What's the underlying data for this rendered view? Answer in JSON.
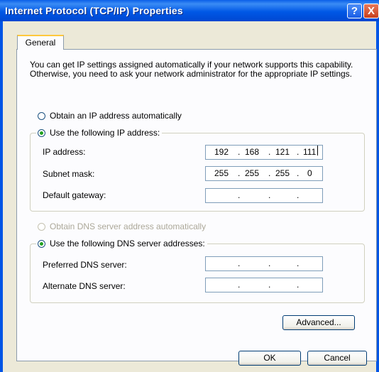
{
  "window": {
    "title": "Internet Protocol (TCP/IP) Properties",
    "help_label": "?",
    "close_label": "X"
  },
  "tabs": [
    {
      "label": "General",
      "active": true
    }
  ],
  "intro_text": "You can get IP settings assigned automatically if your network supports this capability. Otherwise, you need to ask your network administrator for the appropriate IP settings.",
  "ip_section": {
    "auto_label": "Obtain an IP address automatically",
    "auto_selected": false,
    "manual_label": "Use the following IP address:",
    "manual_selected": true,
    "fields": [
      {
        "label": "IP address:",
        "octets": [
          "192",
          "168",
          "121",
          "111"
        ]
      },
      {
        "label": "Subnet mask:",
        "octets": [
          "255",
          "255",
          "255",
          "0"
        ]
      },
      {
        "label": "Default gateway:",
        "octets": [
          "",
          "",
          "",
          ""
        ]
      }
    ]
  },
  "dns_section": {
    "auto_label": "Obtain DNS server address automatically",
    "auto_selected": false,
    "auto_enabled": false,
    "manual_label": "Use the following DNS server addresses:",
    "manual_selected": true,
    "fields": [
      {
        "label": "Preferred DNS server:",
        "octets": [
          "",
          "",
          "",
          ""
        ]
      },
      {
        "label": "Alternate DNS server:",
        "octets": [
          "",
          "",
          "",
          ""
        ]
      }
    ]
  },
  "buttons": {
    "advanced": "Advanced...",
    "ok": "OK",
    "cancel": "Cancel"
  },
  "ip_separator": "."
}
